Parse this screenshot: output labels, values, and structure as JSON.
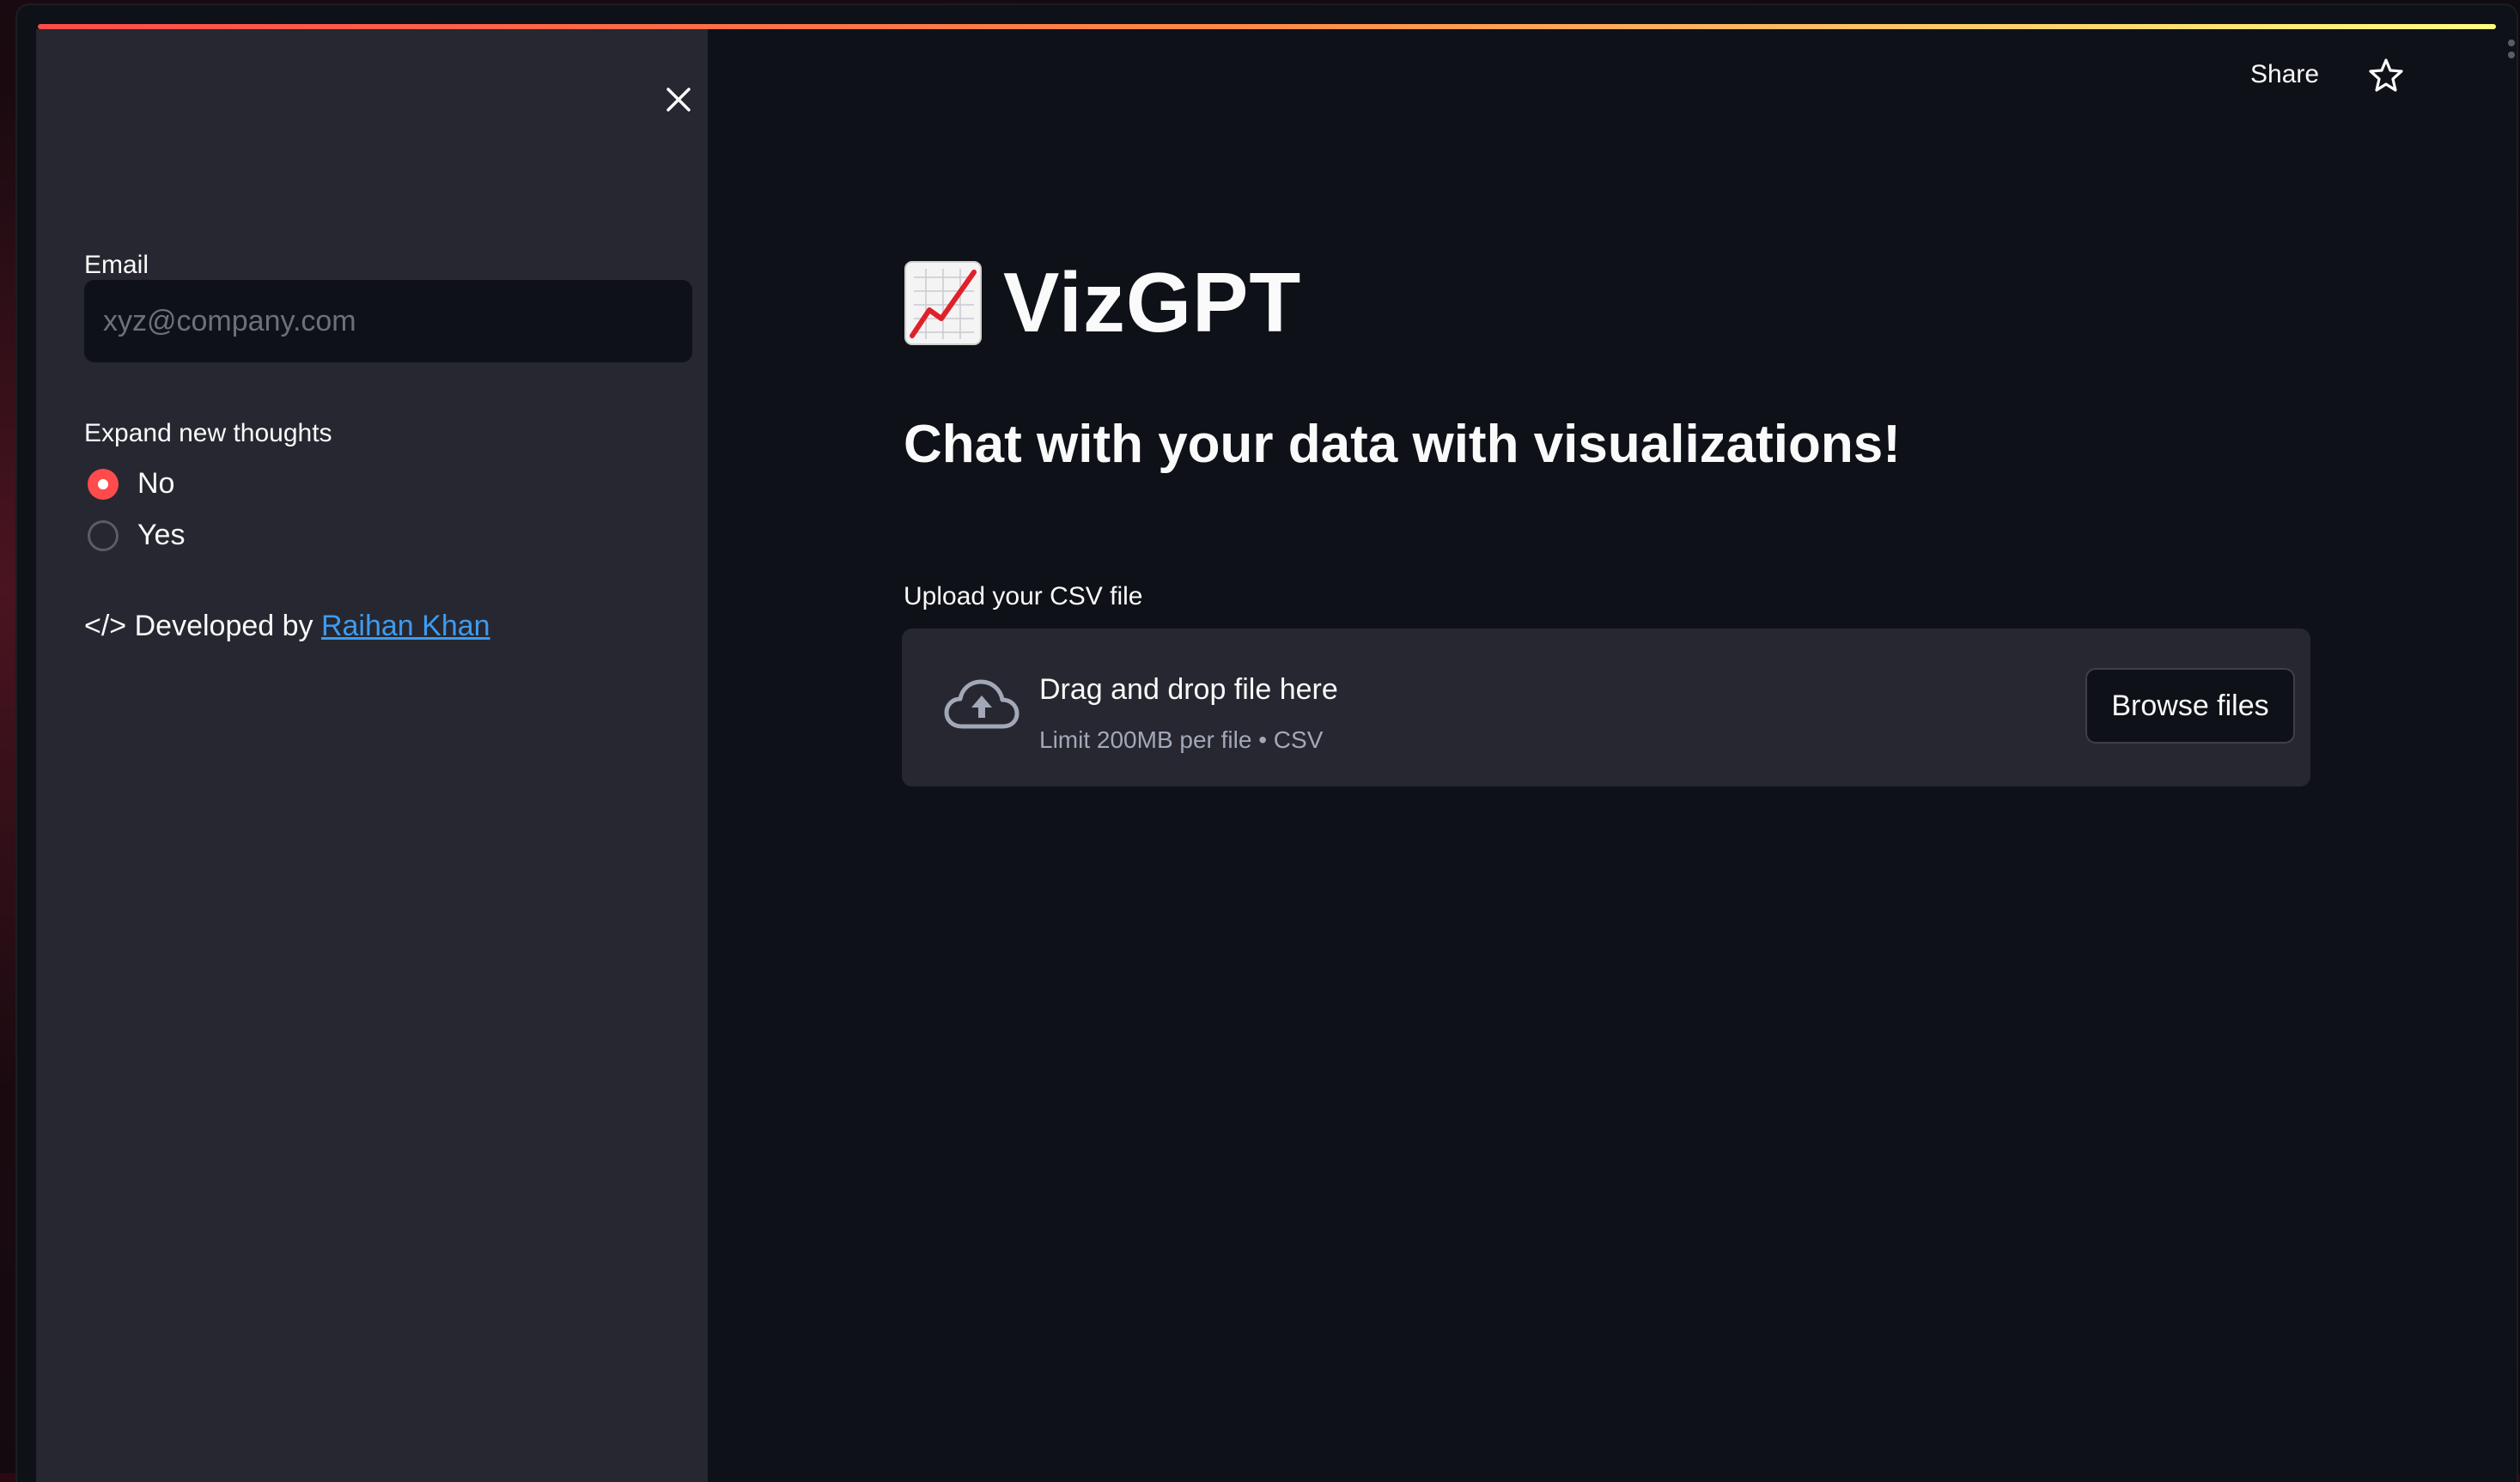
{
  "sidebar": {
    "close_icon": "close-icon",
    "email_label": "Email",
    "email_placeholder": "xyz@company.com",
    "email_value": "",
    "expand_label": "Expand new thoughts",
    "options": [
      {
        "label": "No",
        "selected": true
      },
      {
        "label": "Yes",
        "selected": false
      }
    ],
    "dev_prefix": "</> Developed by ",
    "dev_link": "Raihan Khan"
  },
  "header": {
    "share_label": "Share",
    "star_icon": "star-icon"
  },
  "main": {
    "emoji_icon": "chart-increasing-icon",
    "title": "VizGPT",
    "subtitle": "Chat with your data with visualizations!",
    "upload_label": "Upload your CSV file",
    "dropzone": {
      "icon": "cloud-upload-icon",
      "main_text": "Drag and drop file here",
      "sub_text": "Limit 200MB per file • CSV",
      "button_label": "Browse files"
    }
  },
  "colors": {
    "accent": "#ff4b4b",
    "link": "#3e9bf0",
    "background": "#0e1117",
    "sidebar": "#262730"
  }
}
